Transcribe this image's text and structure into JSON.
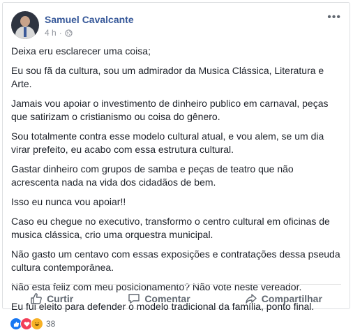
{
  "post": {
    "author": "Samuel Cavalcante",
    "time": "4 h",
    "paragraphs": [
      "Deixa eru esclarecer uma coisa;",
      "Eu sou fã da cultura, sou um admirador da Musica Clássica, Literatura e Arte.",
      "Jamais vou apoiar o investimento de dinheiro publico em carnaval, peças que satirizam o cristianismo ou coisa do gênero.",
      "Sou totalmente contra esse modelo cultural atual, e vou alem, se um dia virar prefeito, eu acabo com essa estrutura cultural.",
      "Gastar dinheiro com grupos de samba e peças de teatro que não acrescenta nada na vida dos cidadãos de bem.",
      "Isso eu nunca vou apoiar!!",
      "Caso eu chegue no executivo, transformo o centro cultural em oficinas de musica clássica, crio uma orquestra municipal.",
      "Não gasto um centavo com essas exposições e contratações dessa pseuda cultura contemporânea.",
      "Não esta feliz com meu posicionamento? Não vote neste vereador.",
      "Eu fui eleito para defender o modelo tradicional da família, ponto final."
    ]
  },
  "actions": {
    "like": "Curtir",
    "comment": "Comentar",
    "share": "Compartilhar"
  },
  "reactions": {
    "count": "38",
    "icons": [
      "like-icon",
      "love-icon",
      "haha-icon"
    ]
  },
  "colors": {
    "link": "#365899",
    "text": "#1d2129",
    "secondary": "#90949c",
    "like": "#1877f2",
    "love": "#f33e58",
    "haha": "#f7b125"
  }
}
